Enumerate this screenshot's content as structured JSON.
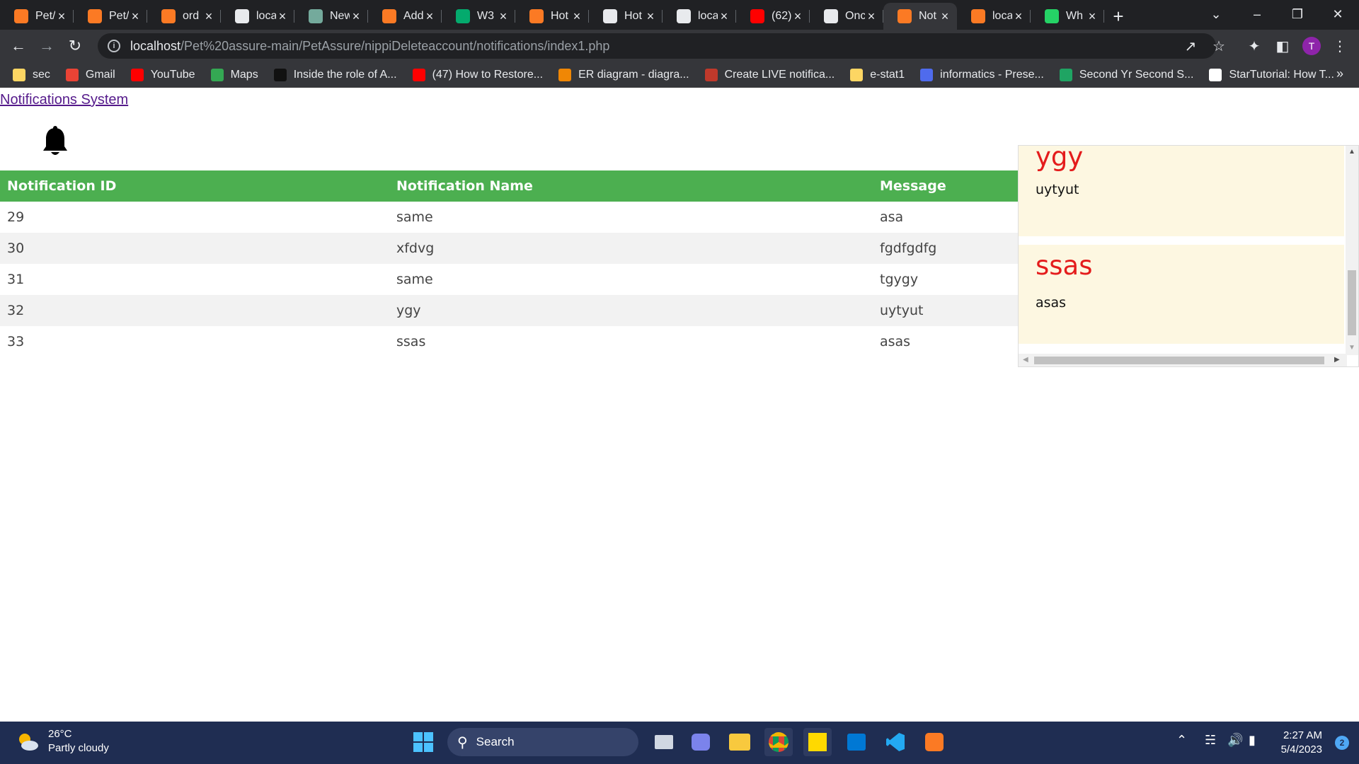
{
  "browser": {
    "tabs": [
      {
        "label": "Pet/",
        "icon": "xampp-icon",
        "color": "#fb7a24"
      },
      {
        "label": "Pet/",
        "icon": "xampp-icon",
        "color": "#fb7a24"
      },
      {
        "label": "ord",
        "icon": "xampp-icon",
        "color": "#fb7a24"
      },
      {
        "label": "loca",
        "icon": "mountain-icon",
        "color": "#e8eaed"
      },
      {
        "label": "New",
        "icon": "openai-icon",
        "color": "#74aa9c"
      },
      {
        "label": "Add",
        "icon": "xampp-icon",
        "color": "#fb7a24"
      },
      {
        "label": "W3",
        "icon": "w3schools-icon",
        "color": "#04aa6d"
      },
      {
        "label": "Hot",
        "icon": "xampp-icon",
        "color": "#fb7a24"
      },
      {
        "label": "Hot",
        "icon": "globe-icon",
        "color": "#e8eaed"
      },
      {
        "label": "loca",
        "icon": "mountain-icon",
        "color": "#e8eaed"
      },
      {
        "label": "(62)",
        "icon": "youtube-icon",
        "color": "#ff0000"
      },
      {
        "label": "Onc",
        "icon": "globe-icon",
        "color": "#e8eaed"
      },
      {
        "label": "Not",
        "icon": "xampp-icon",
        "color": "#fb7a24",
        "active": true
      },
      {
        "label": "loca",
        "icon": "xampp-icon",
        "color": "#fb7a24"
      },
      {
        "label": "Wh",
        "icon": "whatsapp-icon",
        "color": "#25d366"
      }
    ],
    "url_host": "localhost",
    "url_path": "/Pet%20assure-main/PetAssure/nippiDeleteaccount/notifications/index1.php",
    "profile_initial": "T",
    "bookmarks": [
      {
        "label": "sec",
        "color": "#fdd663"
      },
      {
        "label": "Gmail",
        "color": "#ea4335"
      },
      {
        "label": "YouTube",
        "color": "#ff0000"
      },
      {
        "label": "Maps",
        "color": "#34a853"
      },
      {
        "label": "Inside the role of A...",
        "color": "#111111"
      },
      {
        "label": "(47) How to Restore...",
        "color": "#ff0000"
      },
      {
        "label": "ER diagram - diagra...",
        "color": "#f08705"
      },
      {
        "label": "Create LIVE notifica...",
        "color": "#c0392b"
      },
      {
        "label": "e-stat1",
        "color": "#fdd663"
      },
      {
        "label": "informatics - Prese...",
        "color": "#4f6bed"
      },
      {
        "label": "Second Yr Second S...",
        "color": "#1fa463"
      },
      {
        "label": "StarTutorial: How T...",
        "color": "#ffffff"
      }
    ]
  },
  "page": {
    "title_link": "Notifications System",
    "table": {
      "headers": [
        "Notification ID",
        "Notification Name",
        "Message"
      ],
      "rows": [
        [
          "29",
          "same",
          "asa"
        ],
        [
          "30",
          "xfdvg",
          "fgdfgdfg"
        ],
        [
          "31",
          "same",
          "tgygy"
        ],
        [
          "32",
          "ygy",
          "uytyut"
        ],
        [
          "33",
          "ssas",
          "asas"
        ]
      ]
    },
    "panel": {
      "cards": [
        {
          "name": "ygy",
          "message": "uytyut"
        },
        {
          "name": "ssas",
          "message": "asas"
        }
      ]
    }
  },
  "taskbar": {
    "temperature": "26°C",
    "weather": "Partly cloudy",
    "search_label": "Search",
    "time": "2:27 AM",
    "date": "5/4/2023",
    "notification_count": "2"
  }
}
